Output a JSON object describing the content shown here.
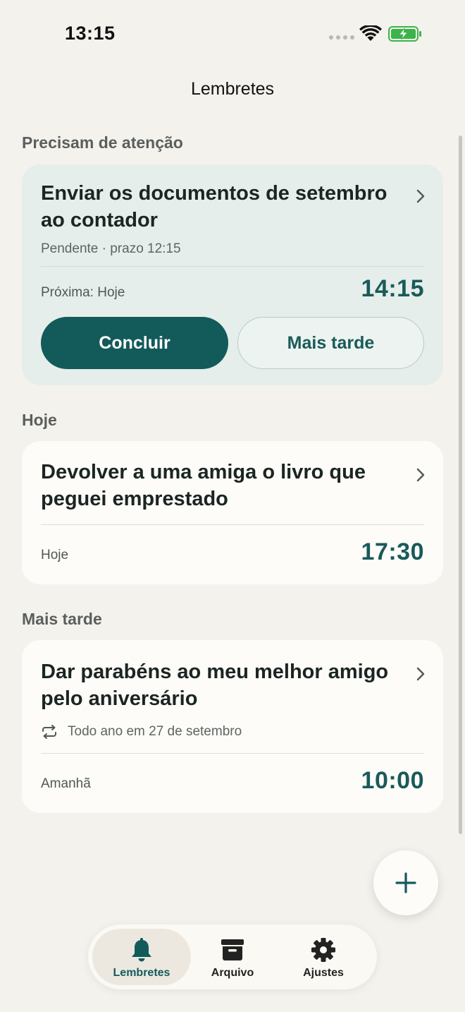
{
  "status_bar": {
    "time": "13:15"
  },
  "header": {
    "title": "Lembretes"
  },
  "sections": {
    "attention": {
      "label": "Precisam de atenção",
      "card": {
        "title": "Enviar os documentos de setembro ao contador",
        "subtitle": "Pendente · prazo 12:15",
        "next_label": "Próxima: Hoje",
        "time": "14:15",
        "primary_button": "Concluir",
        "secondary_button": "Mais tarde"
      }
    },
    "today": {
      "label": "Hoje",
      "card": {
        "title": "Devolver a uma amiga o livro que peguei emprestado",
        "day": "Hoje",
        "time": "17:30"
      }
    },
    "later": {
      "label": "Mais tarde",
      "card": {
        "title": "Dar parabéns ao meu melhor amigo pelo aniversário",
        "repeat": "Todo ano em 27 de setembro",
        "day": "Amanhã",
        "time": "10:00"
      }
    }
  },
  "tab_bar": {
    "items": [
      {
        "label": "Lembretes",
        "icon": "bell-icon",
        "active": true
      },
      {
        "label": "Arquivo",
        "icon": "archive-icon",
        "active": false
      },
      {
        "label": "Ajustes",
        "icon": "gear-icon",
        "active": false
      }
    ]
  },
  "colors": {
    "accent": "#135a5b",
    "background": "#f4f2ed",
    "attention_card": "#e5eeea",
    "card": "#fdfcf8"
  }
}
